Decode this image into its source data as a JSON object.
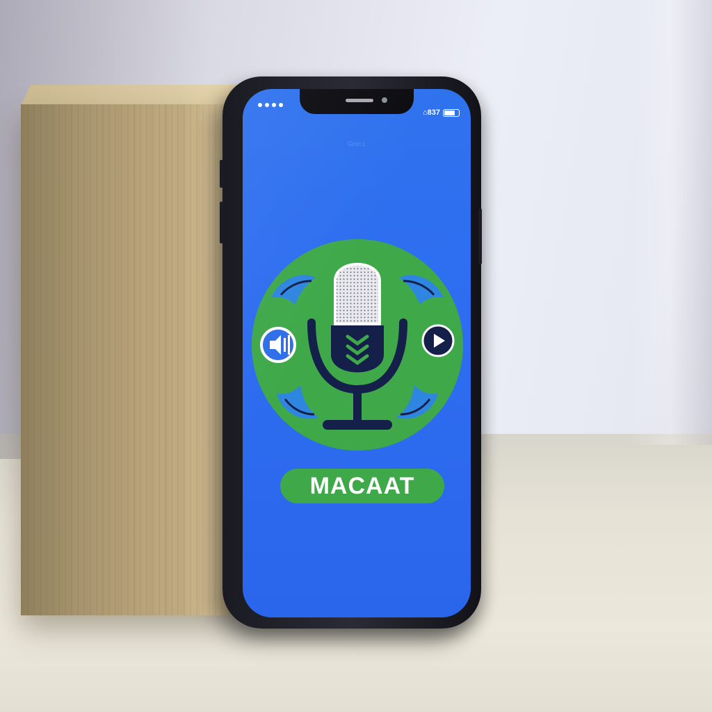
{
  "status_bar": {
    "indicator": "••••",
    "right_text": "⌂837"
  },
  "screen": {
    "title": "Gmn L"
  },
  "logo": {
    "icon": "podcast-microphone-icon",
    "left_button_icon": "volume-icon",
    "right_button_icon": "play-icon"
  },
  "app": {
    "name": "MACAAT"
  },
  "colors": {
    "screen_blue": "#2f6ff0",
    "logo_green": "#3fa94a",
    "navy": "#14204a",
    "accent_blue": "#2f86e0"
  }
}
